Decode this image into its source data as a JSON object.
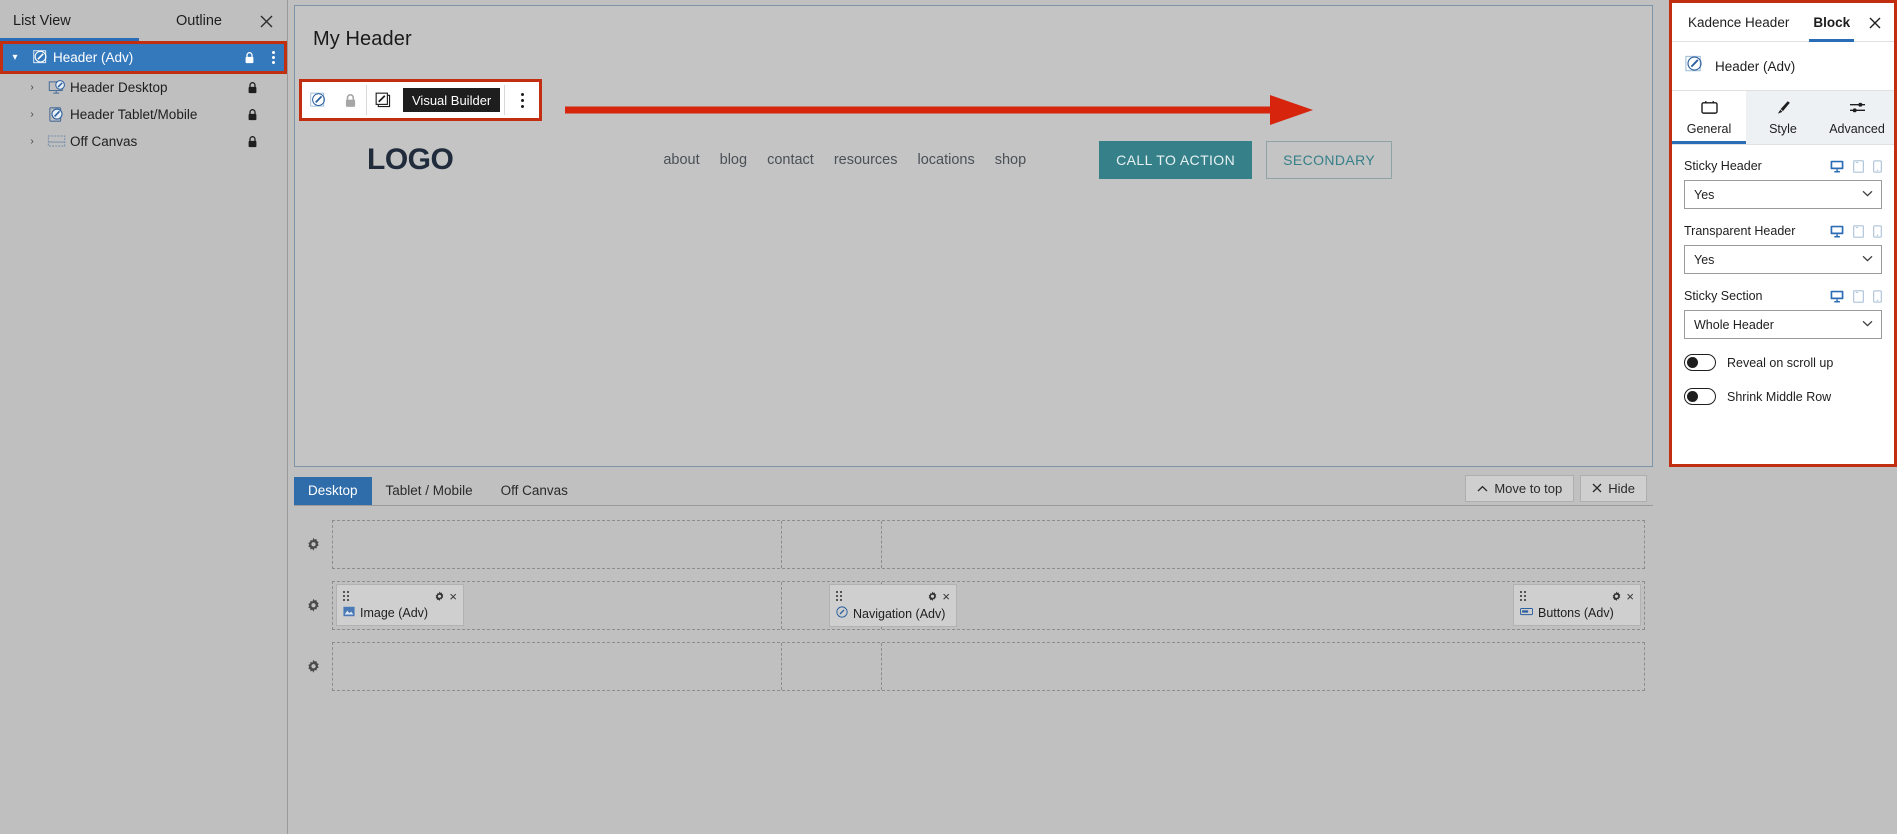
{
  "sidebar": {
    "tabs": [
      {
        "label": "List View",
        "active": true
      },
      {
        "label": "Outline",
        "active": false
      }
    ],
    "close_icon": "close-icon",
    "items": [
      {
        "label": "Header (Adv)",
        "icon": "header-adv-icon",
        "selected": true,
        "locked": true,
        "expanded": true,
        "depth": 0
      },
      {
        "label": "Header Desktop",
        "icon": "desktop-block-icon",
        "selected": false,
        "locked": true,
        "expanded": false,
        "depth": 1
      },
      {
        "label": "Header Tablet/Mobile",
        "icon": "tablet-block-icon",
        "selected": false,
        "locked": true,
        "expanded": false,
        "depth": 1
      },
      {
        "label": "Off Canvas",
        "icon": "off-canvas-icon",
        "selected": false,
        "locked": true,
        "expanded": false,
        "depth": 1
      }
    ]
  },
  "canvas": {
    "title": "My Header",
    "toolbar": {
      "edit_icon": "header-adv-edit-icon",
      "lock_icon": "lock-icon",
      "select_parent_icon": "select-block-icon",
      "tooltip": "Visual Builder",
      "more_icon": "kebab-menu-icon"
    },
    "annotation_arrow": "red-arrow-pointing-right",
    "header_preview": {
      "logo": "LOGO",
      "nav": [
        "about",
        "blog",
        "contact",
        "resources",
        "locations",
        "shop"
      ],
      "primary_button": "CALL TO ACTION",
      "secondary_button": "SECONDARY",
      "primary_color": "#36808a",
      "secondary_text_color": "#36808a"
    }
  },
  "builder": {
    "tabs": [
      {
        "label": "Desktop",
        "active": true
      },
      {
        "label": "Tablet / Mobile",
        "active": false
      },
      {
        "label": "Off Canvas",
        "active": false
      }
    ],
    "actions": [
      {
        "label": "Move to top",
        "icon": "chevron-up-icon"
      },
      {
        "label": "Hide",
        "icon": "close-icon"
      }
    ],
    "rows": [
      {
        "name": "top-row",
        "gear_icon": "gear-icon",
        "items": []
      },
      {
        "name": "middle-row",
        "gear_icon": "gear-icon",
        "items": [
          {
            "label": "Image (Adv)",
            "icon": "image-icon",
            "align": "left",
            "gear_icon": "gear-icon",
            "close_icon": "close-icon",
            "drag_icon": "drag-handle-icon"
          },
          {
            "label": "Navigation (Adv)",
            "icon": "navigation-icon",
            "align": "right",
            "gear_icon": "gear-icon",
            "close_icon": "close-icon",
            "drag_icon": "drag-handle-icon"
          },
          {
            "label": "Buttons (Adv)",
            "icon": "buttons-icon",
            "align": "right",
            "gear_icon": "gear-icon",
            "close_icon": "close-icon",
            "drag_icon": "drag-handle-icon"
          }
        ]
      },
      {
        "name": "bottom-row",
        "gear_icon": "gear-icon",
        "items": []
      }
    ]
  },
  "inspector": {
    "tabs": [
      {
        "label": "Kadence Header",
        "active": false
      },
      {
        "label": "Block",
        "active": true
      }
    ],
    "close_icon": "close-icon",
    "block_name": "Header (Adv)",
    "block_icon": "header-adv-icon",
    "subtabs": [
      {
        "label": "General",
        "icon": "general-icon",
        "active": true
      },
      {
        "label": "Style",
        "icon": "brush-icon",
        "active": false
      },
      {
        "label": "Advanced",
        "icon": "sliders-icon",
        "active": false
      }
    ],
    "fields": [
      {
        "label": "Sticky Header",
        "value": "Yes",
        "devices": [
          {
            "name": "desktop-icon",
            "active": true
          },
          {
            "name": "tablet-icon",
            "active": false
          },
          {
            "name": "mobile-icon",
            "active": false
          }
        ]
      },
      {
        "label": "Transparent Header",
        "value": "Yes",
        "devices": [
          {
            "name": "desktop-icon",
            "active": true
          },
          {
            "name": "tablet-icon",
            "active": false
          },
          {
            "name": "mobile-icon",
            "active": false
          }
        ]
      },
      {
        "label": "Sticky Section",
        "value": "Whole Header",
        "devices": [
          {
            "name": "desktop-icon",
            "active": true
          },
          {
            "name": "tablet-icon",
            "active": false
          },
          {
            "name": "mobile-icon",
            "active": false
          }
        ]
      }
    ],
    "toggles": [
      {
        "label": "Reveal on scroll up",
        "on": false
      },
      {
        "label": "Shrink Middle Row",
        "on": false
      }
    ]
  },
  "colors": {
    "selection_red": "#c22e10",
    "selection_blue": "#3579bd",
    "tab_accent": "#2a6cb5",
    "teal": "#36808a"
  }
}
